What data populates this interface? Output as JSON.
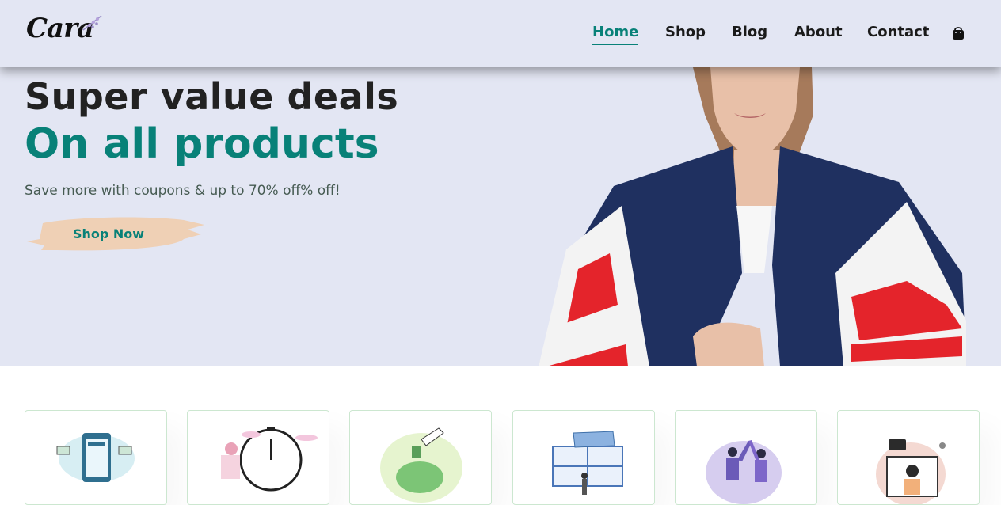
{
  "brand": {
    "logo_text": "Cara"
  },
  "nav": {
    "items": [
      {
        "label": "Home",
        "active": true
      },
      {
        "label": "Shop",
        "active": false
      },
      {
        "label": "Blog",
        "active": false
      },
      {
        "label": "About",
        "active": false
      },
      {
        "label": "Contact",
        "active": false
      }
    ],
    "cart_icon": "shopping-bag-icon"
  },
  "hero": {
    "title_line1": "Super value deals",
    "title_line2": "On all products",
    "subtitle": "Save more with coupons & up to 70% off% off!",
    "button_label": "Shop Now"
  },
  "features": [
    {
      "icon": "online-payment-illustration"
    },
    {
      "icon": "fast-delivery-illustration"
    },
    {
      "icon": "save-money-illustration"
    },
    {
      "icon": "promotions-illustration"
    },
    {
      "icon": "happy-sell-illustration"
    },
    {
      "icon": "support-illustration"
    }
  ],
  "colors": {
    "accent": "#088178",
    "header_bg": "#e3e6f3",
    "text_dark": "#222222",
    "button_brush": "#efd0b5"
  }
}
